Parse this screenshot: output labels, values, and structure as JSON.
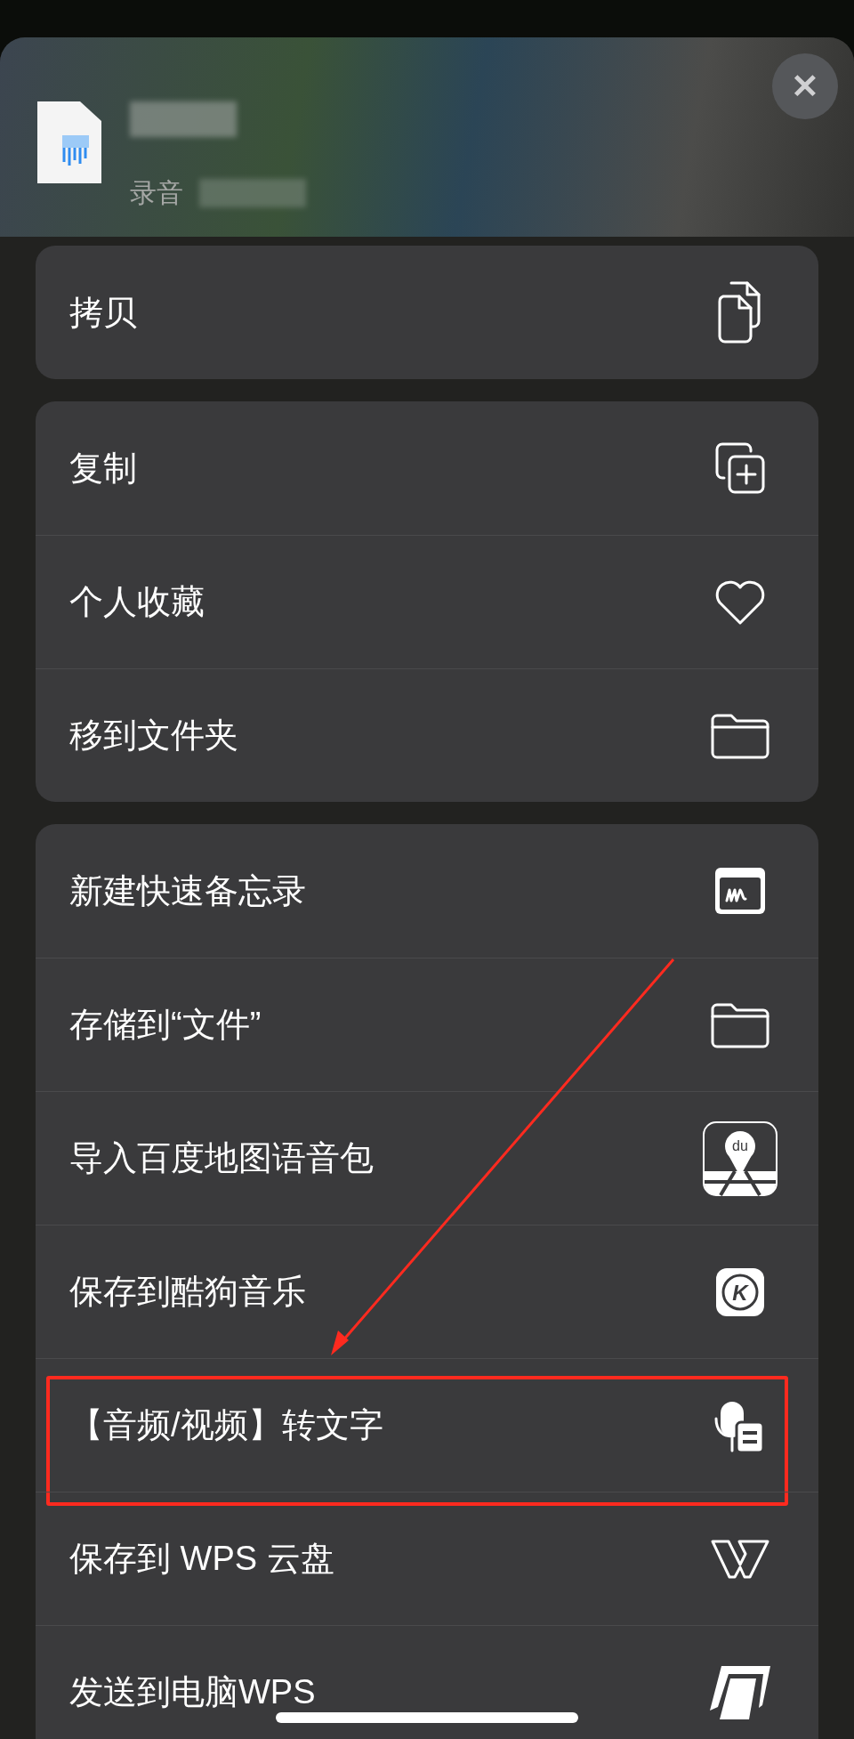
{
  "header": {
    "subtitle": "录音",
    "close_label": "✕"
  },
  "groups": [
    {
      "rows": [
        {
          "label": "拷贝",
          "kind": "copy",
          "highlighted": false
        }
      ]
    },
    {
      "rows": [
        {
          "label": "复制",
          "kind": "duplicate",
          "highlighted": false
        },
        {
          "label": "个人收藏",
          "kind": "heart",
          "highlighted": false
        },
        {
          "label": "移到文件夹",
          "kind": "folder",
          "highlighted": false
        }
      ]
    },
    {
      "rows": [
        {
          "label": "新建快速备忘录",
          "kind": "memo",
          "highlighted": false
        },
        {
          "label": "存储到“文件”",
          "kind": "folder",
          "highlighted": false
        },
        {
          "label": "导入百度地图语音包",
          "kind": "map",
          "badge": "du",
          "highlighted": false
        },
        {
          "label": "保存到酷狗音乐",
          "kind": "kugou",
          "badge": "K",
          "highlighted": false
        },
        {
          "label": "【音频/视频】转文字",
          "kind": "voice",
          "highlighted": true
        },
        {
          "label": "保存到 WPS 云盘",
          "kind": "wps",
          "highlighted": false
        },
        {
          "label": "发送到电脑WPS",
          "kind": "pc",
          "highlighted": false
        }
      ]
    }
  ]
}
